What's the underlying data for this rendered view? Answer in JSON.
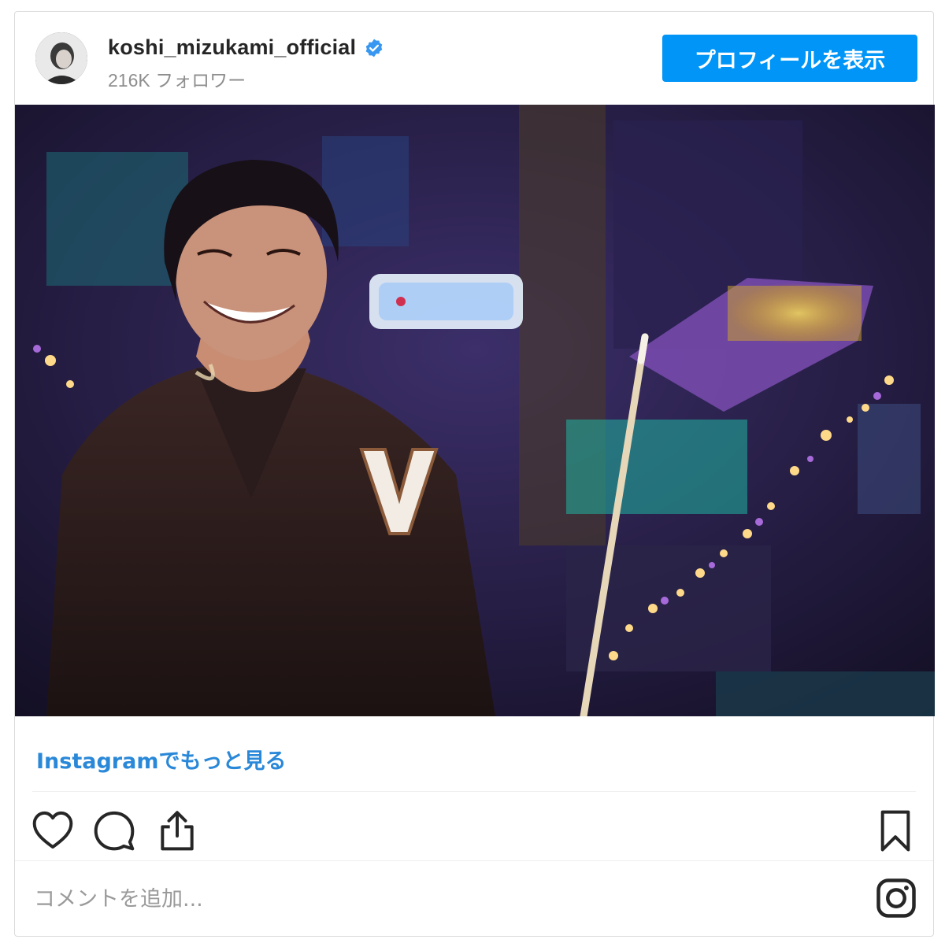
{
  "header": {
    "username": "koshi_mizukami_official",
    "followers": "216K フォロワー",
    "profile_button": "プロフィールを表示",
    "verified_icon": "verified-badge-icon",
    "accent_color": "#0095f6"
  },
  "post": {
    "image_alt": "",
    "more_link": "Instagramでもっと見る"
  },
  "actions": {
    "like_icon": "heart-icon",
    "comment_icon": "comment-icon",
    "share_icon": "share-icon",
    "save_icon": "bookmark-icon"
  },
  "comment": {
    "placeholder": "コメントを追加...",
    "brand_icon": "instagram-icon"
  }
}
